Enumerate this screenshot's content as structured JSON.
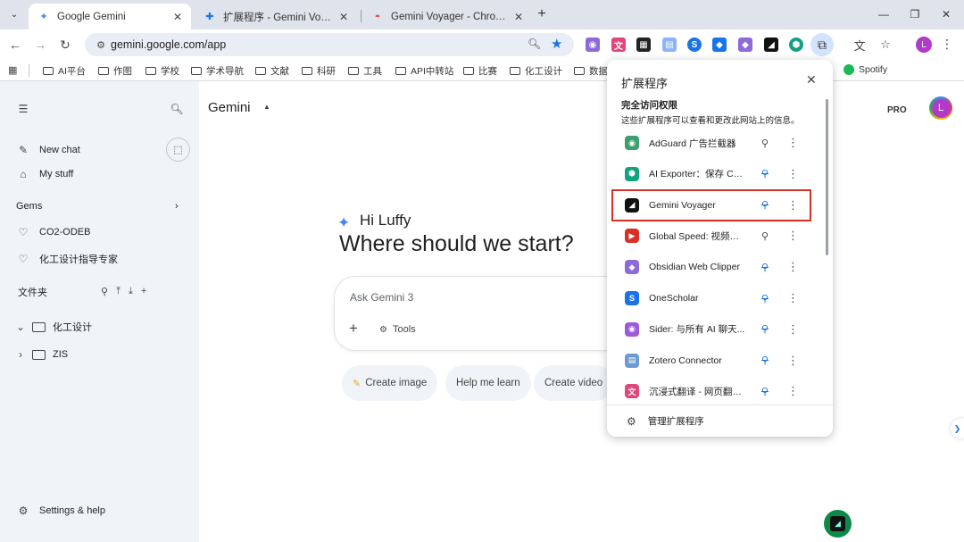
{
  "tabs": [
    {
      "title": "Google Gemini",
      "icon": "gemini-sparkle-icon",
      "active": true
    },
    {
      "title": "扩展程序 - Gemini Voyager",
      "icon": "puzzle-icon",
      "active": false
    },
    {
      "title": "Gemini Voyager - Chrome W",
      "icon": "chrome-web-store-icon",
      "active": false
    }
  ],
  "toolbar": {
    "url": "gemini.google.com/app",
    "avatar_letter": "L"
  },
  "bookmarks": [
    "AI平台",
    "作图",
    "学校",
    "学术导航",
    "文献",
    "科研",
    "工具",
    "API中转站",
    "比赛",
    "化工设计",
    "数据"
  ],
  "bookmark_spotify": "Spotify",
  "sidebar": {
    "new_chat": "New chat",
    "my_stuff": "My stuff",
    "gems_label": "Gems",
    "gems": [
      "CO2-ODEB",
      "化工设计指导专家"
    ],
    "folder_section": "文件夹",
    "folders": [
      "化工设计",
      "ZIS"
    ],
    "settings": "Settings & help"
  },
  "main": {
    "app_title": "Gemini",
    "pro_badge": "PRO",
    "avatar_letter": "L",
    "greeting": "Hi Luffy",
    "headline": "Where should we start?",
    "prompt_placeholder": "Ask Gemini 3",
    "tools_label": "Tools",
    "chips": [
      "Create image",
      "Help me learn",
      "Create video"
    ]
  },
  "extensions_panel": {
    "title": "扩展程序",
    "section_title": "完全访问权限",
    "section_desc": "这些扩展程序可以查看和更改此网站上的信息。",
    "items": [
      {
        "name": "AdGuard 广告拦截器",
        "icon_color": "#3e9f6e",
        "pinned": true,
        "highlight": false
      },
      {
        "name": "AI Exporter：保存 ChatGPT",
        "icon_color": "#10a37f",
        "pinned": false,
        "highlight": false
      },
      {
        "name": "Gemini Voyager",
        "icon_color": "#111111",
        "pinned": false,
        "highlight": true
      },
      {
        "name": "Global Speed: 视频速度控制",
        "icon_color": "#d93025",
        "pinned": true,
        "highlight": false
      },
      {
        "name": "Obsidian Web Clipper",
        "icon_color": "#8e6ad8",
        "pinned": false,
        "highlight": false
      },
      {
        "name": "OneScholar",
        "icon_color": "#1a73e8",
        "pinned": false,
        "highlight": false
      },
      {
        "name": "Sider: 与所有 AI 聊天...",
        "icon_color": "#9c5bd9",
        "pinned": false,
        "highlight": false
      },
      {
        "name": "Zotero Connector",
        "icon_color": "#6c9bd2",
        "pinned": false,
        "highlight": false
      },
      {
        "name": "沉浸式翻译 - 网页翻译插件",
        "icon_color": "#e0457b",
        "pinned": false,
        "highlight": false
      }
    ],
    "manage_label": "管理扩展程序"
  }
}
